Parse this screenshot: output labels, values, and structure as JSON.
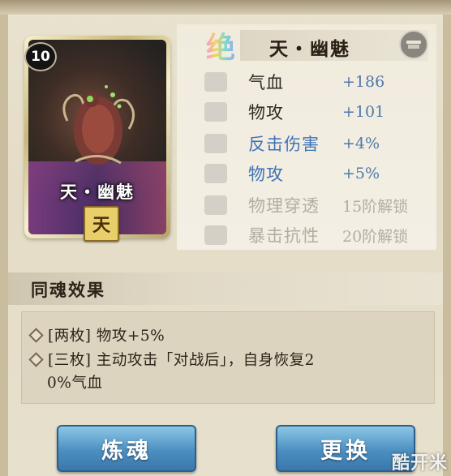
{
  "card": {
    "level": "10",
    "name": "天・幽魅",
    "tier": "天"
  },
  "soul": {
    "rarity_glyph": "绝",
    "name": "天・幽魅",
    "settings_icon": "tray-icon"
  },
  "stats": [
    {
      "name": "气血",
      "value": "+186",
      "icon": "heart-icon",
      "state": "active"
    },
    {
      "name": "物攻",
      "value": "+101",
      "icon": "sword-icon",
      "state": "active"
    },
    {
      "name": "反击伤害",
      "value": "+4%",
      "icon": "sword-icon",
      "state": "bonus"
    },
    {
      "name": "物攻",
      "value": "+5%",
      "icon": "sword-icon",
      "state": "bonus"
    },
    {
      "name": "物理穿透",
      "value": "15阶解锁",
      "icon": "sword-icon",
      "state": "locked"
    },
    {
      "name": "暴击抗性",
      "value": "20阶解锁",
      "icon": "shield-icon",
      "state": "locked"
    }
  ],
  "set_effect": {
    "title": "同魂效果",
    "lines": [
      "[两枚] 物攻+5%",
      "[三枚] 主动攻击「对战后」，自身恢复2",
      "0%气血"
    ]
  },
  "buttons": {
    "refine": "炼魂",
    "replace": "更换"
  },
  "watermark": "酷开米",
  "colors": {
    "bonus_text": "#3f73b8",
    "value_text": "#4f79aa",
    "locked_text": "#b3aea4",
    "button_blue": "#4c8fc0"
  }
}
